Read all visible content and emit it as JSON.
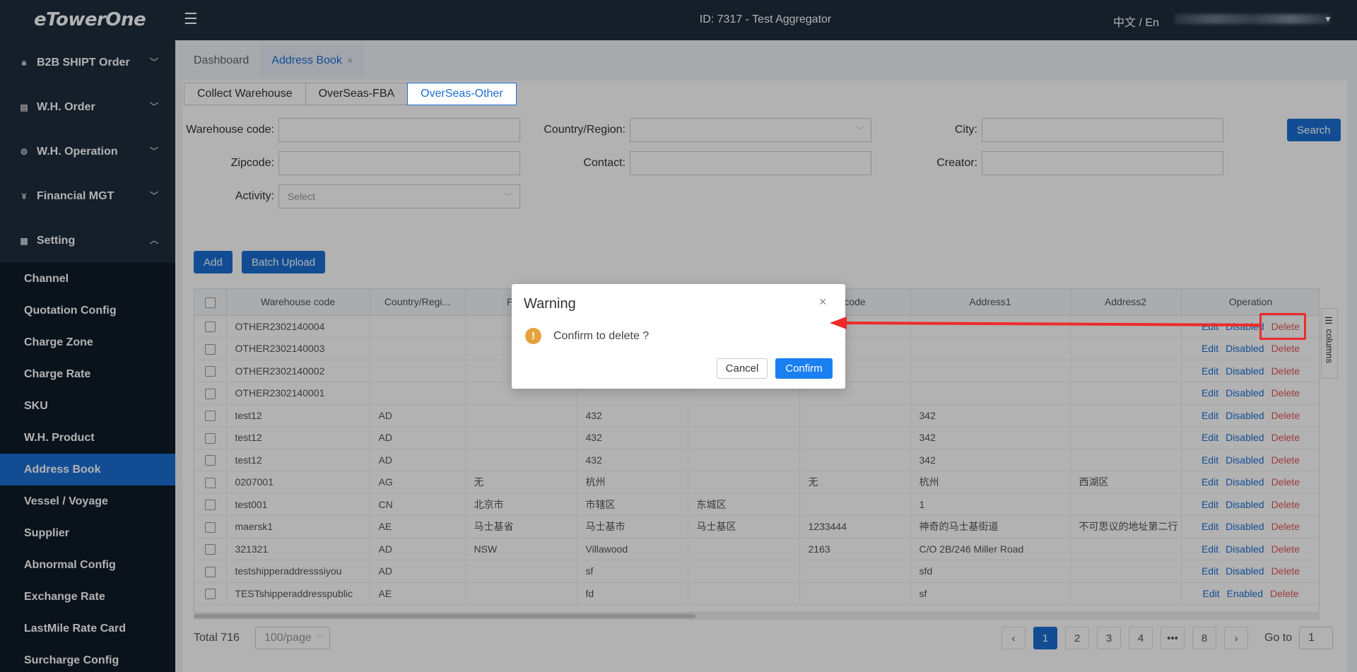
{
  "header": {
    "logo": "eTowerOne",
    "title": "ID: 7317 - Test Aggregator",
    "lang": "中文 / En"
  },
  "sidebar": {
    "groups": [
      {
        "label": "B2B SHIPT Order",
        "icon": "lock-icon"
      },
      {
        "label": "W.H. Order",
        "icon": "list-icon"
      },
      {
        "label": "W.H. Operation",
        "icon": "gear-icon"
      },
      {
        "label": "Financial MGT",
        "icon": "yuan-icon"
      },
      {
        "label": "Setting",
        "icon": "grid-icon"
      }
    ],
    "items": [
      "Channel",
      "Quotation Config",
      "Charge Zone",
      "Charge Rate",
      "SKU",
      "W.H. Product",
      "Address Book",
      "Vessel / Voyage",
      "Supplier",
      "Abnormal Config",
      "Exchange Rate",
      "LastMile Rate Card",
      "Surcharge Config"
    ]
  },
  "tabs": {
    "dashboard": "Dashboard",
    "address_book": "Address Book",
    "close": "×"
  },
  "subtabs": [
    "Collect Warehouse",
    "OverSeas-FBA",
    "OverSeas-Other"
  ],
  "filters": {
    "warehouse_code": "Warehouse code:",
    "country_region": "Country/Region:",
    "city": "City:",
    "zipcode": "Zipcode:",
    "contact": "Contact:",
    "creator": "Creator:",
    "activity": "Activity:",
    "activity_placeholder": "Select",
    "search": "Search"
  },
  "actions": {
    "add": "Add",
    "batch_upload": "Batch Upload"
  },
  "table": {
    "headers": [
      "Warehouse code",
      "Country/Regi...",
      "Provin",
      "",
      "",
      "code",
      "Address1",
      "Address2",
      "Operation"
    ],
    "rows": [
      [
        "OTHER2302140004",
        "",
        "",
        "",
        "",
        "",
        "",
        "",
        "Disabled"
      ],
      [
        "OTHER2302140003",
        "",
        "",
        "",
        "",
        "",
        "",
        "",
        "Disabled"
      ],
      [
        "OTHER2302140002",
        "",
        "",
        "",
        "",
        "",
        "",
        "",
        "Disabled"
      ],
      [
        "OTHER2302140001",
        "",
        "",
        "",
        "",
        "",
        "",
        "",
        "Disabled"
      ],
      [
        "test12",
        "AD",
        "",
        "432",
        "",
        "",
        "342",
        "",
        "Disabled"
      ],
      [
        "test12",
        "AD",
        "",
        "432",
        "",
        "",
        "342",
        "",
        "Disabled"
      ],
      [
        "test12",
        "AD",
        "",
        "432",
        "",
        "",
        "342",
        "",
        "Disabled"
      ],
      [
        "0207001",
        "AG",
        "无",
        "杭州",
        "",
        "无",
        "杭州",
        "西湖区",
        "Disabled"
      ],
      [
        "test001",
        "CN",
        "北京市",
        "市辖区",
        "东城区",
        "",
        "1",
        "",
        "Disabled"
      ],
      [
        "maersk1",
        "AE",
        "马士基省",
        "马士基市",
        "马士基区",
        "1233444",
        "神奇的马士基街道",
        "不可思议的地址第二行",
        "Disabled"
      ],
      [
        "321321",
        "AD",
        "NSW",
        "Villawood",
        "",
        "2163",
        "C/O 2B/246 Miller Road",
        "",
        "Disabled"
      ],
      [
        "testshipperaddresssiyou",
        "AD",
        "",
        "sf",
        "",
        "",
        "sfd",
        "",
        "Disabled"
      ],
      [
        "TESTshipperaddresspublic",
        "AE",
        "",
        "fd",
        "",
        "",
        "sf",
        "",
        "Enabled"
      ]
    ],
    "op_edit": "Edit",
    "op_delete": "Delete",
    "columns_toggle": "☰ columns"
  },
  "pagination": {
    "total": "Total 716",
    "page_size": "100/page",
    "prev": "‹",
    "pages": [
      "1",
      "2",
      "3",
      "4",
      "•••",
      "8"
    ],
    "next": "›",
    "goto_label": "Go to",
    "goto_value": "1"
  },
  "modal": {
    "title": "Warning",
    "close": "×",
    "icon": "!",
    "message": "Confirm to delete ?",
    "cancel": "Cancel",
    "confirm": "Confirm"
  },
  "annotation": {
    "color": "#ee2a2a"
  }
}
